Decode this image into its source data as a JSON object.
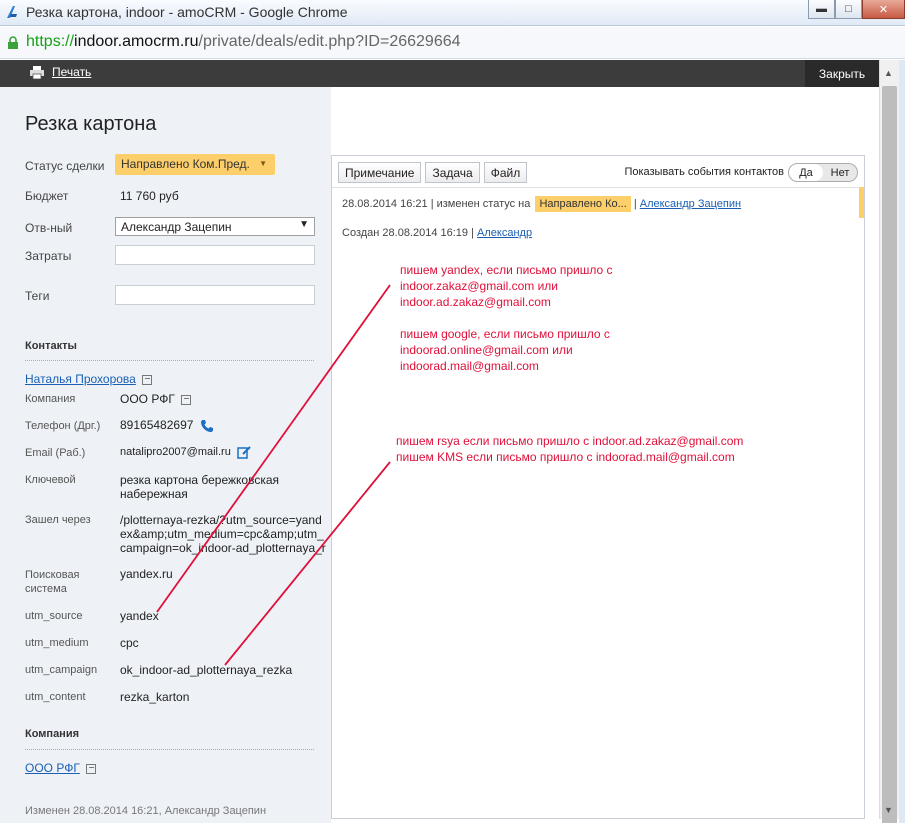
{
  "window": {
    "title": "Резка картона, indoor - amoCRM - Google Chrome",
    "url_scheme": "https://",
    "url_host": "indoor.amocrm.ru",
    "url_path": "/private/deals/edit.php?ID=26629664",
    "minimize_glyph": "▬",
    "maximize_glyph": "□",
    "close_glyph": "✕"
  },
  "toolbar": {
    "print_label": "Печать",
    "close_label": "Закрыть"
  },
  "scrollbar": {
    "up_glyph": "▲",
    "down_glyph": "▼"
  },
  "deal": {
    "title": "Резка картона",
    "status_label": "Статус сделки",
    "status_value": "Направлено Ком.Пред.",
    "status_arrow": "▼",
    "budget_label": "Бюджет",
    "budget_value": "11 760  руб",
    "owner_label": "Отв-ный",
    "owner_value": "Александр Зацепин",
    "owner_arrow": "▼",
    "costs_label": "Затраты",
    "tags_label": "Теги"
  },
  "contacts": {
    "heading": "Контакты",
    "name": "Наталья Прохорова",
    "fields": [
      {
        "label": "Компания",
        "value": "ООО РФГ"
      },
      {
        "label": "Телефон (Дрг.)",
        "value": "89165482697"
      },
      {
        "label": "Email (Раб.)",
        "value": "natalipro2007@mail.ru"
      },
      {
        "label": "Ключевой",
        "value": "резка картона бережковская набережная"
      },
      {
        "label": "Зашел через",
        "value": "/plotternaya-rezka/?utm_source=yandex&amp;utm_medium=cpc&amp;utm_campaign=ok_indoor-ad_plotternaya_rezka&amp;utm_content=rezka_karton"
      },
      {
        "label": "Поисковая система",
        "value": "yandex.ru"
      },
      {
        "label": "utm_source",
        "value": "yandex"
      },
      {
        "label": "utm_medium",
        "value": "cpc"
      },
      {
        "label": "utm_campaign",
        "value": "ok_indoor-ad_plotternaya_rezka"
      },
      {
        "label": "utm_content",
        "value": "rezka_karton"
      }
    ]
  },
  "company": {
    "heading": "Компания",
    "name": "ООО РФГ"
  },
  "footer": {
    "modified": "Изменен 28.08.2014 16:21, Александр Зацепин"
  },
  "feed": {
    "tabs": [
      "Примечание",
      "Задача",
      "Файл"
    ],
    "show_contact_events_label": "Показывать события контактов",
    "toggle_yes": "Да",
    "toggle_no": "Нет",
    "event1_text": "28.08.2014 16:21  |  изменен статус на",
    "event1_status": "Направлено Ко...",
    "event1_sep": "|",
    "event1_user": "Александр Зацепин",
    "event2_text": "Создан 28.08.2014 16:19  |",
    "event2_user": "Александр"
  },
  "annotations": {
    "block1": [
      "пишем yandex, если письмо пришло с",
      "indoor.zakaz@gmail.com или",
      "indoor.ad.zakaz@gmail.com",
      "",
      "пишем google, если письмо пришло с",
      "indoorad.online@gmail.com или",
      "indoorad.mail@gmail.com"
    ],
    "block2": [
      "пишем rsya если письмо пришло с indoor.ad.zakaz@gmail.com",
      "пишем KMS если письмо пришло с indoorad.mail@gmail.com"
    ],
    "color": "#e0103a"
  }
}
